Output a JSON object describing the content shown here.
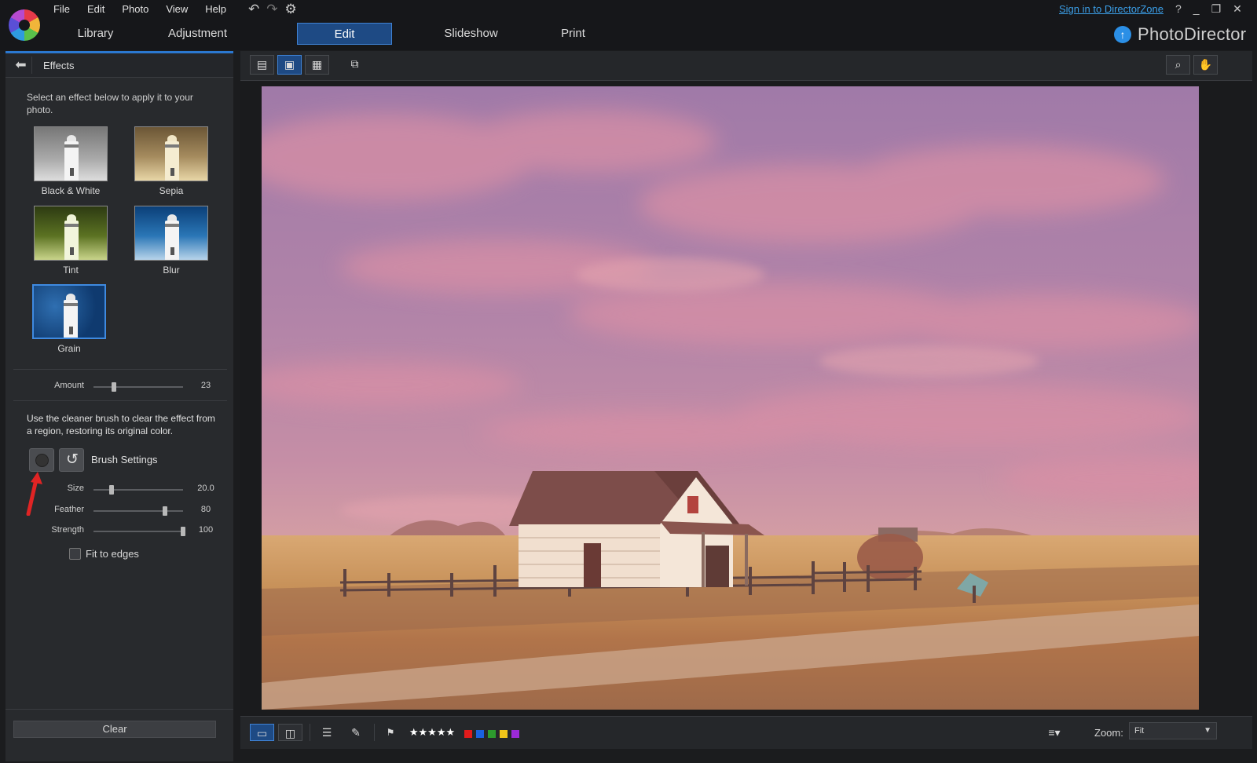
{
  "app": {
    "name": "PhotoDirector",
    "menus": [
      "File",
      "Edit",
      "Photo",
      "View",
      "Help"
    ],
    "signin": "Sign in to DirectorZone",
    "help_glyph": "?",
    "window_controls": [
      "_",
      "❐",
      "✕"
    ]
  },
  "tabs": [
    "Library",
    "Adjustment",
    "Edit",
    "Slideshow",
    "Print"
  ],
  "active_tab": "Edit",
  "panel": {
    "title": "Effects",
    "intro": "Select an effect below to apply it to your photo.",
    "effects": [
      {
        "label": "Black & White",
        "icon": "bw-thumbnail"
      },
      {
        "label": "Sepia",
        "icon": "sepia-thumbnail"
      },
      {
        "label": "Tint",
        "icon": "tint-thumbnail"
      },
      {
        "label": "Blur",
        "icon": "blur-thumbnail"
      },
      {
        "label": "Grain",
        "icon": "grain-thumbnail"
      }
    ],
    "selected_effect": "Grain",
    "amount": {
      "label": "Amount",
      "value": "23",
      "fraction": 0.23
    },
    "cleaner_text": "Use the cleaner brush to clear the effect from a region, restoring its original color.",
    "brush_settings_label": "Brush Settings",
    "brush": [
      {
        "label": "Size",
        "value": "20.0",
        "fraction": 0.2
      },
      {
        "label": "Feather",
        "value": "80",
        "fraction": 0.8
      },
      {
        "label": "Strength",
        "value": "100",
        "fraction": 1.0
      }
    ],
    "fit_to_edges": {
      "label": "Fit to edges",
      "checked": false
    },
    "clear_label": "Clear"
  },
  "bottom": {
    "stars": "★★★★★",
    "color_labels": [
      "#e11b1b",
      "#1a62e0",
      "#2d9b2d",
      "#f0c419",
      "#9b2ad6"
    ],
    "zoom_label": "Zoom:",
    "zoom_value": "Fit"
  }
}
